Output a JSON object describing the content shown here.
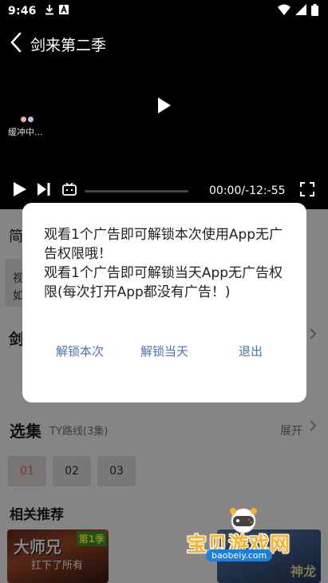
{
  "status_bar": {
    "time": "9:46",
    "left_icons": [
      "download-icon",
      "a-badge-icon"
    ],
    "right_icons": [
      "wifi-icon",
      "signal-icon",
      "battery-icon"
    ]
  },
  "player": {
    "title": "剑来第二季",
    "buffering_text": "缓冲中...",
    "time_display": "00:00/-12:-55",
    "progress": 0
  },
  "page": {
    "intro_label": "简",
    "intro_card_text": "视\n如",
    "episode_heading": "剑",
    "episodes_section": {
      "title": "选集",
      "route": "TY路线(3集)",
      "expand": "展开"
    },
    "episodes": [
      {
        "label": "01",
        "active": true
      },
      {
        "label": "02",
        "active": false
      },
      {
        "label": "03",
        "active": false
      }
    ],
    "recommend_title": "相关推荐",
    "recommend_items": [
      {
        "title": "大师兄",
        "subtitle": "扛下了所有",
        "badge": "第1季"
      },
      {
        "title": "神龙"
      }
    ]
  },
  "dialog": {
    "message_line1": "观看1个广告即可解锁本次使用App无广告权限哦！",
    "message_line2": "观看1个广告即可解锁当天App无广告权限(每次打开App都没有广告！)",
    "buttons": {
      "unlock_once": "解锁本次",
      "unlock_day": "解锁当天",
      "exit": "退出"
    }
  },
  "watermark": {
    "text": "宝贝游戏网",
    "url": "baobeiy.com"
  },
  "colors": {
    "dialog_button": "#4a74b8",
    "active_episode": "#e06a6a",
    "watermark_text": "#f7b32b",
    "watermark_url_bg": "#1d7fd9"
  }
}
